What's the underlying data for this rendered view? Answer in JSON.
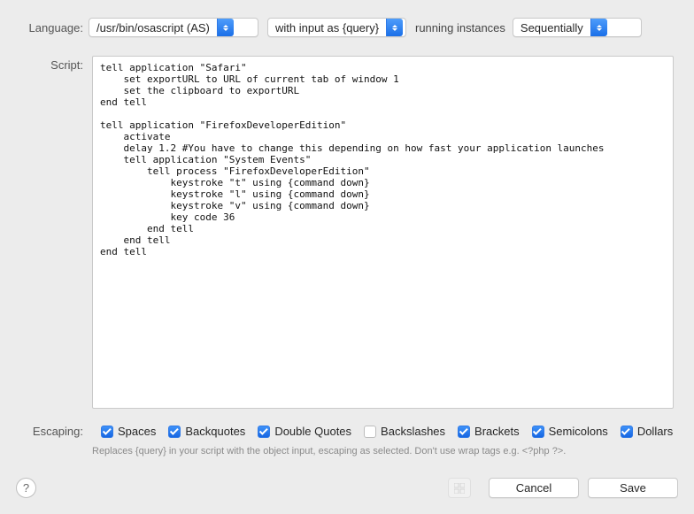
{
  "labels": {
    "language": "Language:",
    "running_instances": "running instances",
    "script": "Script:",
    "escaping": "Escaping:",
    "hint": "Replaces {query} in your script with the object input, escaping as selected. Don't use wrap tags e.g. <?php ?>."
  },
  "selects": {
    "language": "/usr/bin/osascript (AS)",
    "with_input": "with input as {query}",
    "sequential": "Sequentially"
  },
  "script_text": "tell application \"Safari\"\n    set exportURL to URL of current tab of window 1\n    set the clipboard to exportURL\nend tell\n\ntell application \"FirefoxDeveloperEdition\"\n    activate\n    delay 1.2 #You have to change this depending on how fast your application launches\n    tell application \"System Events\"\n        tell process \"FirefoxDeveloperEdition\"\n            keystroke \"t\" using {command down}\n            keystroke \"l\" using {command down}\n            keystroke \"v\" using {command down}\n            key code 36\n        end tell\n    end tell\nend tell",
  "escaping": {
    "spaces": {
      "label": "Spaces",
      "checked": true
    },
    "backquotes": {
      "label": "Backquotes",
      "checked": true
    },
    "double_quotes": {
      "label": "Double Quotes",
      "checked": true
    },
    "backslashes": {
      "label": "Backslashes",
      "checked": false
    },
    "brackets": {
      "label": "Brackets",
      "checked": true
    },
    "semicolons": {
      "label": "Semicolons",
      "checked": true
    },
    "dollars": {
      "label": "Dollars",
      "checked": true
    }
  },
  "buttons": {
    "cancel": "Cancel",
    "save": "Save",
    "help": "?"
  }
}
